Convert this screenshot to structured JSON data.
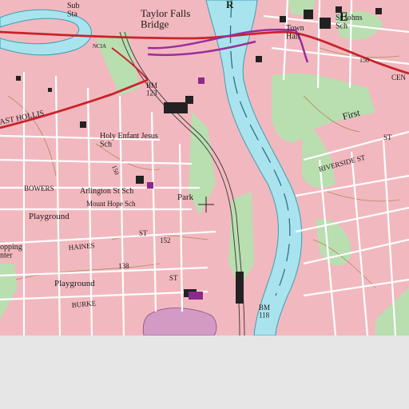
{
  "map": {
    "labels": {
      "sub_sta": "Sub\nSta",
      "taylor_falls_bridge": "Taylor Falls\nBridge",
      "town_hall": "Town\nHall",
      "st_johns_sch": "St Johns\nSch",
      "sch_tr": "Sch",
      "bm_123": "BM\n123",
      "east_hollis": "AST HOLLIS",
      "holy_enfant_jesus": "Holy Enfant Jesus\nSch",
      "first": "First",
      "riverside_st": "RIVERSIDE ST",
      "bowers": "BOWERS",
      "arlington_st_sch": "Arlington St Sch",
      "park": "Park",
      "mount_hope_sch": "Mount Hope Sch",
      "playground_1": "Playground",
      "shopping_center": "opping\nnter",
      "haines": "HAINES",
      "st_mid": "ST",
      "playground_2": "Playground",
      "burke": "BURKE",
      "st_lower": "ST",
      "bm_118": "BM\n118",
      "river_r": "R",
      "road_e": "E",
      "cen": "CEN",
      "contour_150_left": "150",
      "contour_150_right": "150",
      "contour_152": "152",
      "contour_138": "138",
      "route_badge": "NCIA",
      "st_small": "ST"
    },
    "colors": {
      "urban": "#f2b8bf",
      "water": "#a9e4ee",
      "river_edge": "#3a9fb3",
      "forest": "#b9deb0",
      "highway": "#c9232b",
      "purple_line": "#9a2e9a",
      "street": "#ffffff",
      "contour": "#b0895a",
      "building": "#222222",
      "pond": "#d39ac6",
      "below": "#e6e6e6"
    },
    "crosshair_icon": "crosshair-icon",
    "bm_marks": [
      "benchmark-x-icon"
    ]
  }
}
